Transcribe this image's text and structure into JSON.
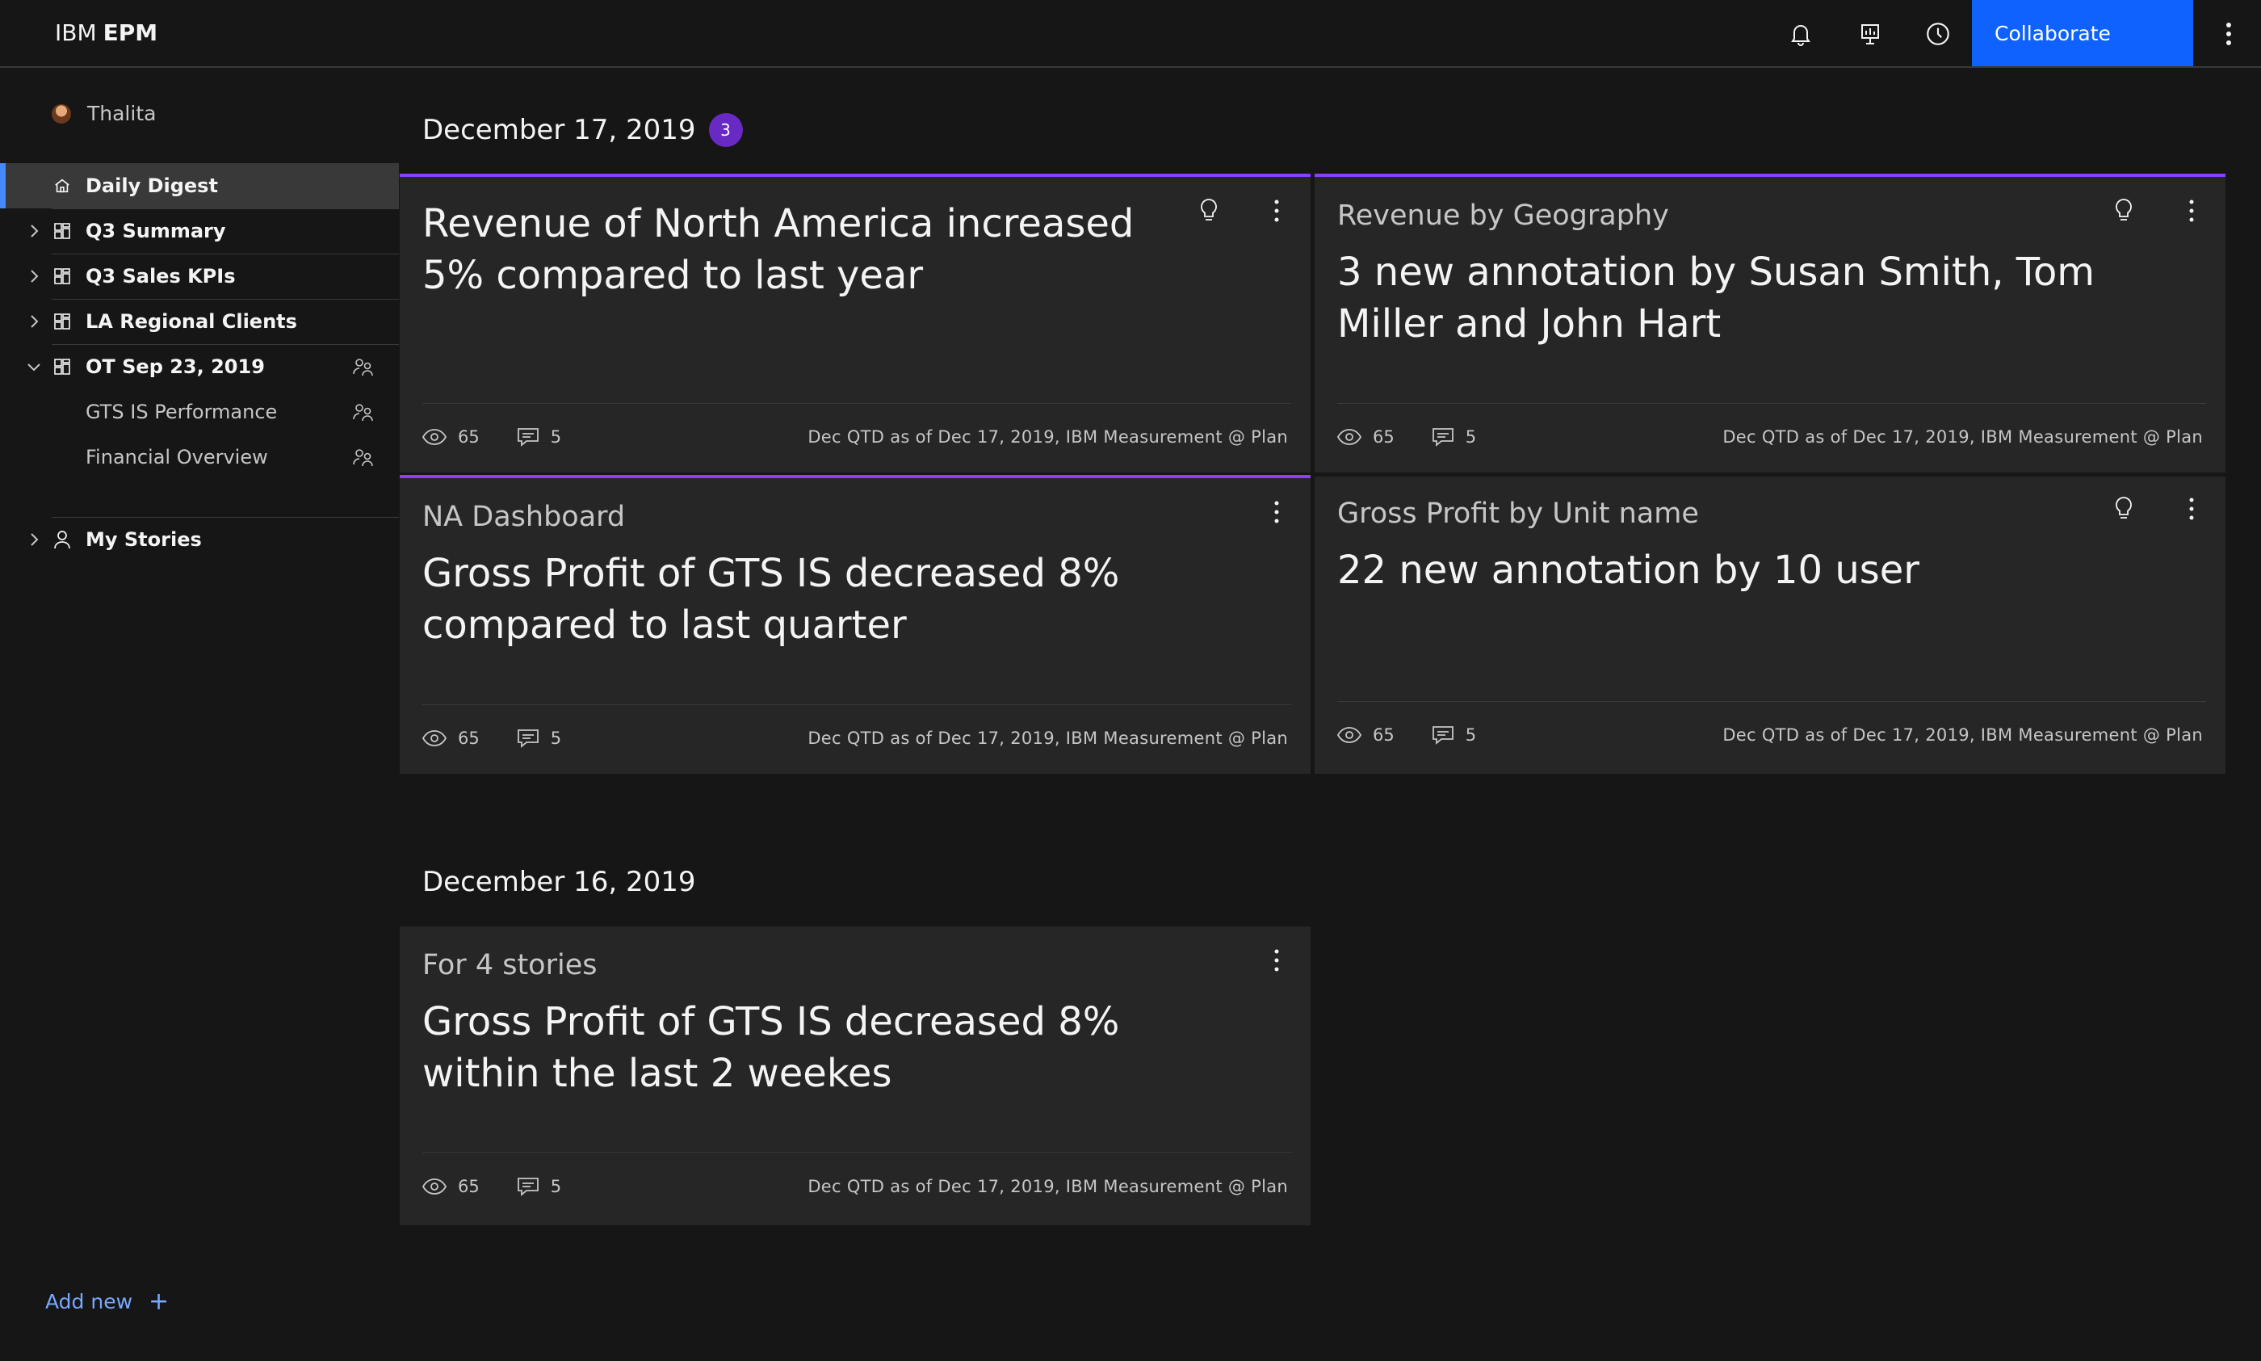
{
  "header": {
    "brand_prefix": "IBM",
    "brand_name": "EPM",
    "collaborate_label": "Collaborate"
  },
  "sidebar": {
    "user_name": "Thalita",
    "items": [
      {
        "label": "Daily Digest"
      },
      {
        "label": "Q3 Summary"
      },
      {
        "label": "Q3 Sales KPIs"
      },
      {
        "label": "LA Regional Clients"
      },
      {
        "label": "OT Sep 23, 2019"
      },
      {
        "label": "GTS IS Performance"
      },
      {
        "label": "Financial Overview"
      },
      {
        "label": "My Stories"
      }
    ],
    "add_new_label": "Add new",
    "add_new_symbol": "+"
  },
  "main": {
    "groups": [
      {
        "date": "December 17, 2019",
        "badge": "3",
        "cards": [
          {
            "subtitle": "",
            "title": "Revenue of North America increased 5% compared to last year",
            "views": "65",
            "comments": "5",
            "meta": "Dec QTD as of Dec 17, 2019, IBM Measurement @ Plan"
          },
          {
            "subtitle": "Revenue by Geography",
            "title": "3 new annotation by Susan Smith, Tom Miller and John Hart",
            "views": "65",
            "comments": "5",
            "meta": "Dec QTD as of Dec 17, 2019, IBM Measurement @ Plan"
          },
          {
            "subtitle": "NA Dashboard",
            "title": "Gross Profit of GTS IS decreased 8% compared to last quarter",
            "views": "65",
            "comments": "5",
            "meta": "Dec QTD as of Dec 17, 2019, IBM Measurement @ Plan"
          },
          {
            "subtitle": "Gross Profit by Unit name",
            "title": "22 new annotation by 10 user",
            "views": "65",
            "comments": "5",
            "meta": "Dec QTD as of Dec 17, 2019, IBM Measurement @ Plan"
          }
        ]
      },
      {
        "date": "December 16, 2019",
        "cards": [
          {
            "subtitle": "For 4 stories",
            "title": "Gross Profit of GTS IS decreased 8% within the last 2 weekes",
            "views": "65",
            "comments": "5",
            "meta": "Dec QTD as of Dec 17, 2019, IBM Measurement @ Plan"
          }
        ]
      }
    ]
  },
  "colors": {
    "background": "#161616",
    "card": "#262626",
    "accent_blue": "#0f62fe",
    "highlight_purple": "#8a3ffc",
    "badge_purple": "#6929c4",
    "link_blue": "#78a9ff"
  }
}
